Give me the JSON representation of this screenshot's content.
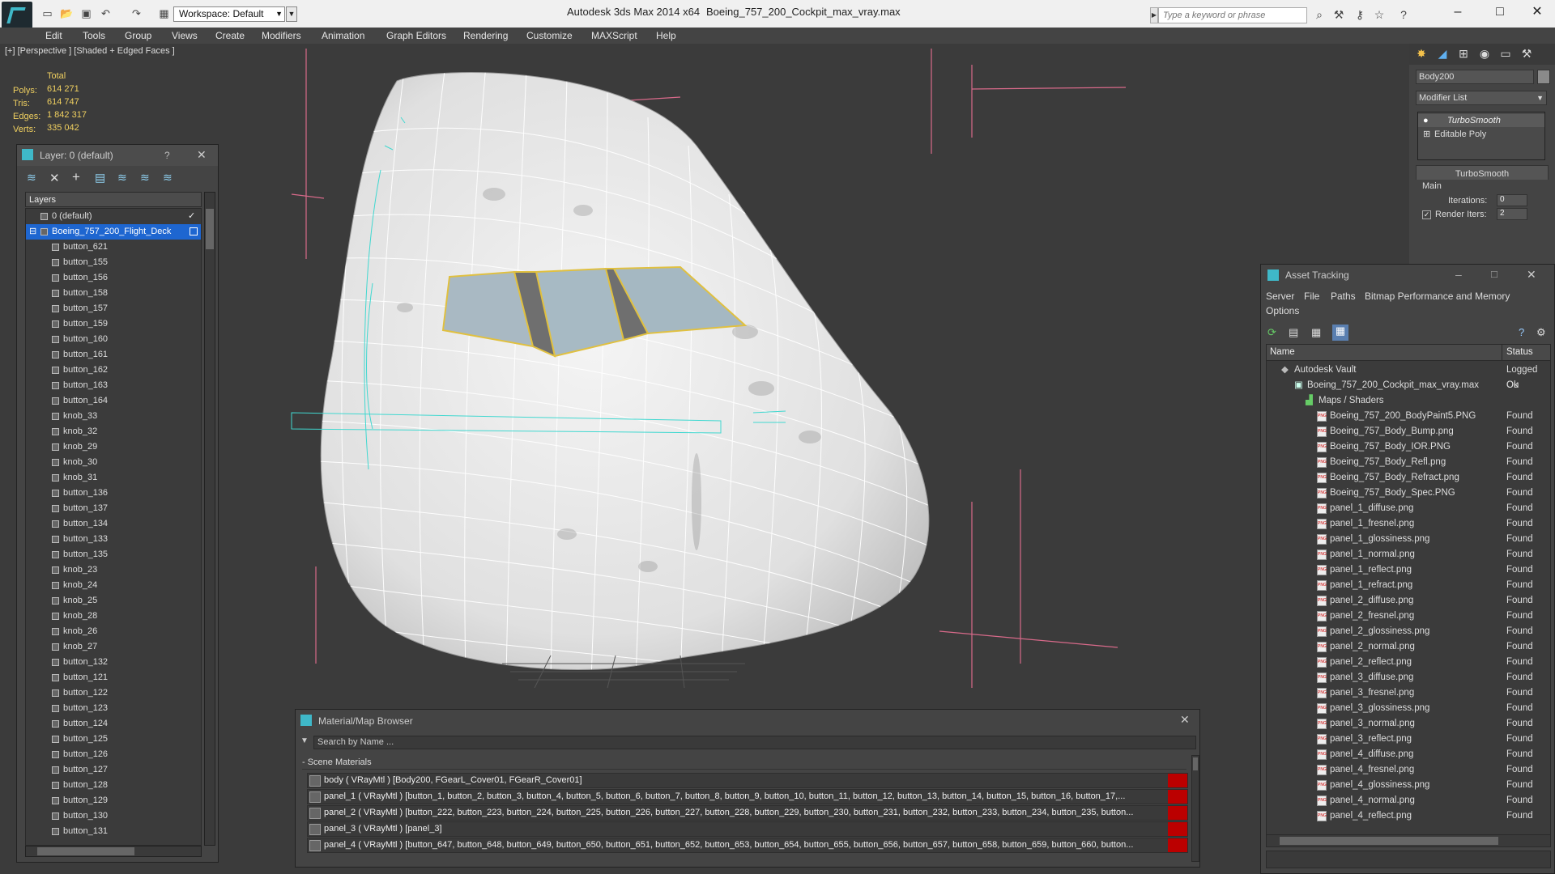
{
  "app": {
    "title": "Autodesk 3ds Max  2014 x64",
    "file": "Boeing_757_200_Cockpit_max_vray.max",
    "workspace": "Workspace: Default",
    "search_placeholder": "Type a keyword or phrase"
  },
  "menu": [
    "Edit",
    "Tools",
    "Group",
    "Views",
    "Create",
    "Modifiers",
    "Animation",
    "Graph Editors",
    "Rendering",
    "Customize",
    "MAXScript",
    "Help"
  ],
  "viewport": {
    "label": "[+] [Perspective ] [Shaded + Edged Faces ]",
    "stats_header": "Total",
    "stats": [
      {
        "label": "Polys:",
        "value": "614 271"
      },
      {
        "label": "Tris:",
        "value": "614 747"
      },
      {
        "label": "Edges:",
        "value": "1 842 317"
      },
      {
        "label": "Verts:",
        "value": "335 042"
      }
    ]
  },
  "layer_panel": {
    "title": "Layer: 0 (default)",
    "help": "?",
    "column": "Layers",
    "items": [
      {
        "name": "0 (default)",
        "level": 1
      },
      {
        "name": "Boeing_757_200_Flight_Deck",
        "level": 1,
        "selected": true
      },
      {
        "name": "button_621",
        "level": 2
      },
      {
        "name": "button_155",
        "level": 2
      },
      {
        "name": "button_156",
        "level": 2
      },
      {
        "name": "button_158",
        "level": 2
      },
      {
        "name": "button_157",
        "level": 2
      },
      {
        "name": "button_159",
        "level": 2
      },
      {
        "name": "button_160",
        "level": 2
      },
      {
        "name": "button_161",
        "level": 2
      },
      {
        "name": "button_162",
        "level": 2
      },
      {
        "name": "button_163",
        "level": 2
      },
      {
        "name": "button_164",
        "level": 2
      },
      {
        "name": "knob_33",
        "level": 2
      },
      {
        "name": "knob_32",
        "level": 2
      },
      {
        "name": "knob_29",
        "level": 2
      },
      {
        "name": "knob_30",
        "level": 2
      },
      {
        "name": "knob_31",
        "level": 2
      },
      {
        "name": "button_136",
        "level": 2
      },
      {
        "name": "button_137",
        "level": 2
      },
      {
        "name": "button_134",
        "level": 2
      },
      {
        "name": "button_133",
        "level": 2
      },
      {
        "name": "button_135",
        "level": 2
      },
      {
        "name": "knob_23",
        "level": 2
      },
      {
        "name": "knob_24",
        "level": 2
      },
      {
        "name": "knob_25",
        "level": 2
      },
      {
        "name": "knob_28",
        "level": 2
      },
      {
        "name": "knob_26",
        "level": 2
      },
      {
        "name": "knob_27",
        "level": 2
      },
      {
        "name": "button_132",
        "level": 2
      },
      {
        "name": "button_121",
        "level": 2
      },
      {
        "name": "button_122",
        "level": 2
      },
      {
        "name": "button_123",
        "level": 2
      },
      {
        "name": "button_124",
        "level": 2
      },
      {
        "name": "button_125",
        "level": 2
      },
      {
        "name": "button_126",
        "level": 2
      },
      {
        "name": "button_127",
        "level": 2
      },
      {
        "name": "button_128",
        "level": 2
      },
      {
        "name": "button_129",
        "level": 2
      },
      {
        "name": "button_130",
        "level": 2
      },
      {
        "name": "button_131",
        "level": 2
      }
    ]
  },
  "command_panel": {
    "object_name": "Body200",
    "modifier_list": "Modifier List",
    "stack": [
      "TurboSmooth",
      "Editable Poly"
    ],
    "rollout": "TurboSmooth",
    "main": "Main",
    "iterations_label": "Iterations:",
    "iterations": "0",
    "render_iters_label": "Render Iters:",
    "render_iters": "2"
  },
  "asset_tracking": {
    "title": "Asset Tracking",
    "menu": [
      "Server",
      "File",
      "Paths",
      "Bitmap Performance and Memory",
      "Options"
    ],
    "col_name": "Name",
    "col_status": "Status",
    "rows": [
      {
        "name": "Autodesk Vault",
        "status": "Logged Ou",
        "level": 0,
        "icon": "vault"
      },
      {
        "name": "Boeing_757_200_Cockpit_max_vray.max",
        "status": "Ok",
        "level": 1,
        "icon": "max"
      },
      {
        "name": "Maps / Shaders",
        "status": "",
        "level": 2,
        "icon": "folder"
      },
      {
        "name": "Boeing_757_200_BodyPaint5.PNG",
        "status": "Found",
        "level": 3,
        "icon": "png"
      },
      {
        "name": "Boeing_757_Body_Bump.png",
        "status": "Found",
        "level": 3,
        "icon": "png"
      },
      {
        "name": "Boeing_757_Body_IOR.PNG",
        "status": "Found",
        "level": 3,
        "icon": "png"
      },
      {
        "name": "Boeing_757_Body_Refl.png",
        "status": "Found",
        "level": 3,
        "icon": "png"
      },
      {
        "name": "Boeing_757_Body_Refract.png",
        "status": "Found",
        "level": 3,
        "icon": "png"
      },
      {
        "name": "Boeing_757_Body_Spec.PNG",
        "status": "Found",
        "level": 3,
        "icon": "png"
      },
      {
        "name": "panel_1_diffuse.png",
        "status": "Found",
        "level": 3,
        "icon": "png"
      },
      {
        "name": "panel_1_fresnel.png",
        "status": "Found",
        "level": 3,
        "icon": "png"
      },
      {
        "name": "panel_1_glossiness.png",
        "status": "Found",
        "level": 3,
        "icon": "png"
      },
      {
        "name": "panel_1_normal.png",
        "status": "Found",
        "level": 3,
        "icon": "png"
      },
      {
        "name": "panel_1_reflect.png",
        "status": "Found",
        "level": 3,
        "icon": "png"
      },
      {
        "name": "panel_1_refract.png",
        "status": "Found",
        "level": 3,
        "icon": "png"
      },
      {
        "name": "panel_2_diffuse.png",
        "status": "Found",
        "level": 3,
        "icon": "png"
      },
      {
        "name": "panel_2_fresnel.png",
        "status": "Found",
        "level": 3,
        "icon": "png"
      },
      {
        "name": "panel_2_glossiness.png",
        "status": "Found",
        "level": 3,
        "icon": "png"
      },
      {
        "name": "panel_2_normal.png",
        "status": "Found",
        "level": 3,
        "icon": "png"
      },
      {
        "name": "panel_2_reflect.png",
        "status": "Found",
        "level": 3,
        "icon": "png"
      },
      {
        "name": "panel_3_diffuse.png",
        "status": "Found",
        "level": 3,
        "icon": "png"
      },
      {
        "name": "panel_3_fresnel.png",
        "status": "Found",
        "level": 3,
        "icon": "png"
      },
      {
        "name": "panel_3_glossiness.png",
        "status": "Found",
        "level": 3,
        "icon": "png"
      },
      {
        "name": "panel_3_normal.png",
        "status": "Found",
        "level": 3,
        "icon": "png"
      },
      {
        "name": "panel_3_reflect.png",
        "status": "Found",
        "level": 3,
        "icon": "png"
      },
      {
        "name": "panel_4_diffuse.png",
        "status": "Found",
        "level": 3,
        "icon": "png"
      },
      {
        "name": "panel_4_fresnel.png",
        "status": "Found",
        "level": 3,
        "icon": "png"
      },
      {
        "name": "panel_4_glossiness.png",
        "status": "Found",
        "level": 3,
        "icon": "png"
      },
      {
        "name": "panel_4_normal.png",
        "status": "Found",
        "level": 3,
        "icon": "png"
      },
      {
        "name": "panel_4_reflect.png",
        "status": "Found",
        "level": 3,
        "icon": "png"
      }
    ]
  },
  "material_browser": {
    "title": "Material/Map Browser",
    "search_placeholder": "Search by Name ...",
    "section": "- Scene Materials",
    "rows": [
      "body  ( VRayMtl )  [Body200, FGearL_Cover01, FGearR_Cover01]",
      "panel_1  ( VRayMtl )  [button_1, button_2, button_3, button_4, button_5, button_6, button_7, button_8, button_9, button_10, button_11, button_12, button_13, button_14, button_15, button_16, button_17,...",
      "panel_2  ( VRayMtl )  [button_222, button_223, button_224, button_225, button_226, button_227, button_228, button_229, button_230, button_231, button_232, button_233, button_234, button_235, button...",
      "panel_3  ( VRayMtl )  [panel_3]",
      "panel_4  ( VRayMtl )  [button_647, button_648, button_649, button_650, button_651, button_652, button_653, button_654, button_655, button_656, button_657, button_658, button_659, button_660, button..."
    ]
  },
  "colors": {
    "accent": "#3fb8c8",
    "selection": "#1e66d0",
    "stats": "#f0d060",
    "material_flag": "#bb0000"
  }
}
